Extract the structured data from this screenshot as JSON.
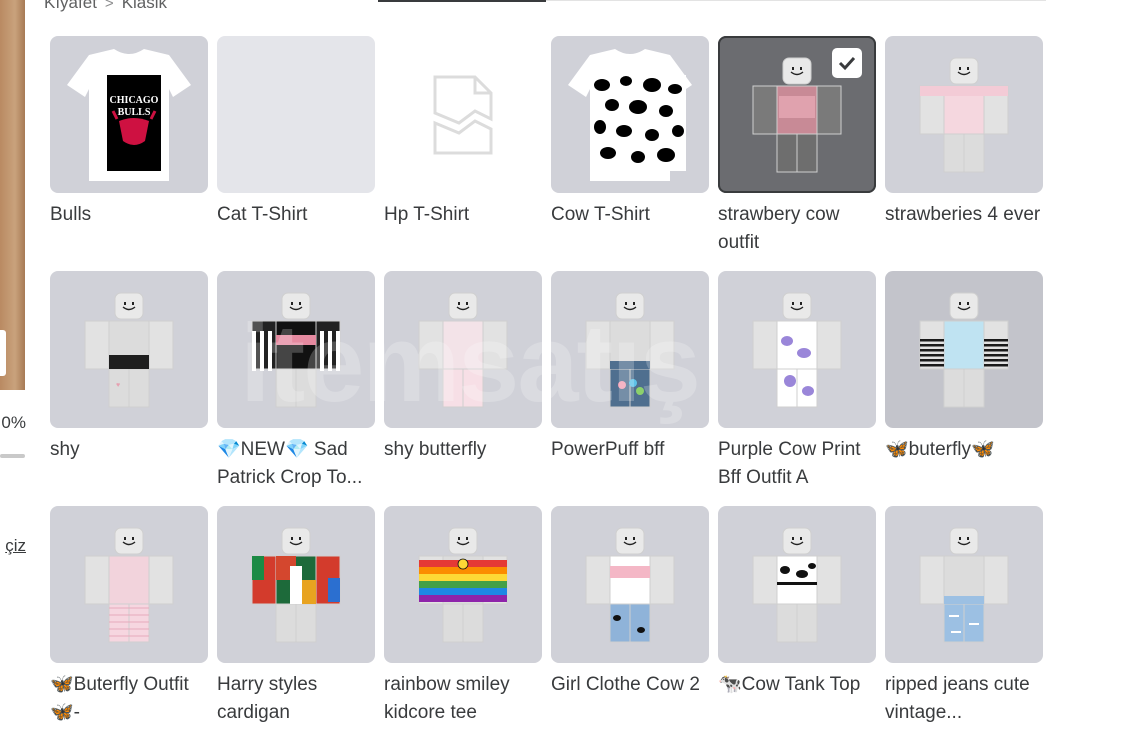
{
  "breadcrumb": {
    "parent": "Kıyafet",
    "current": "Klasik"
  },
  "side": {
    "percent_text": "0%",
    "link_text": "çiz"
  },
  "items": [
    {
      "name": "Bulls",
      "thumb": "tshirt-bulls",
      "selected": false
    },
    {
      "name": "Cat T-Shirt",
      "thumb": "empty-light",
      "selected": false
    },
    {
      "name": "Hp T-Shirt",
      "thumb": "broken-image",
      "selected": false
    },
    {
      "name": "Cow T-Shirt",
      "thumb": "tshirt-cow",
      "selected": false
    },
    {
      "name": "strawbery cow outfit",
      "thumb": "avatar-pink-dark",
      "selected": true
    },
    {
      "name": "strawberies 4 ever",
      "thumb": "avatar-pink-top",
      "selected": false
    },
    {
      "name": "shy",
      "thumb": "avatar-black-band",
      "selected": false
    },
    {
      "name": "💎NEW💎 Sad Patrick Crop To...",
      "thumb": "avatar-checker-crop",
      "selected": false
    },
    {
      "name": "shy butterfly",
      "thumb": "avatar-pink-light",
      "selected": false
    },
    {
      "name": "PowerPuff bff",
      "thumb": "avatar-powerpuff",
      "selected": false
    },
    {
      "name": "Purple Cow Print Bff Outfit A",
      "thumb": "avatar-purple-cow",
      "selected": false
    },
    {
      "name": "🦋buterfly🦋",
      "thumb": "avatar-blue-stripes",
      "selected": false
    },
    {
      "name": "🦋Buterfly Outfit 🦋-",
      "thumb": "avatar-pink-plaid",
      "selected": false
    },
    {
      "name": "Harry styles cardigan",
      "thumb": "avatar-patchwork",
      "selected": false
    },
    {
      "name": "rainbow smiley kidcore tee",
      "thumb": "avatar-rainbow",
      "selected": false
    },
    {
      "name": "Girl Clothe Cow 2",
      "thumb": "avatar-cow-jeans",
      "selected": false
    },
    {
      "name": "🐄Cow Tank Top",
      "thumb": "avatar-cow-tank",
      "selected": false
    },
    {
      "name": "ripped jeans cute vintage...",
      "thumb": "avatar-ripped-jeans",
      "selected": false
    }
  ],
  "watermark": "itemsatış",
  "colors": {
    "card_bg": "#d0d1d8",
    "selected_bg": "#6b6c70",
    "text": "#393b3d"
  }
}
